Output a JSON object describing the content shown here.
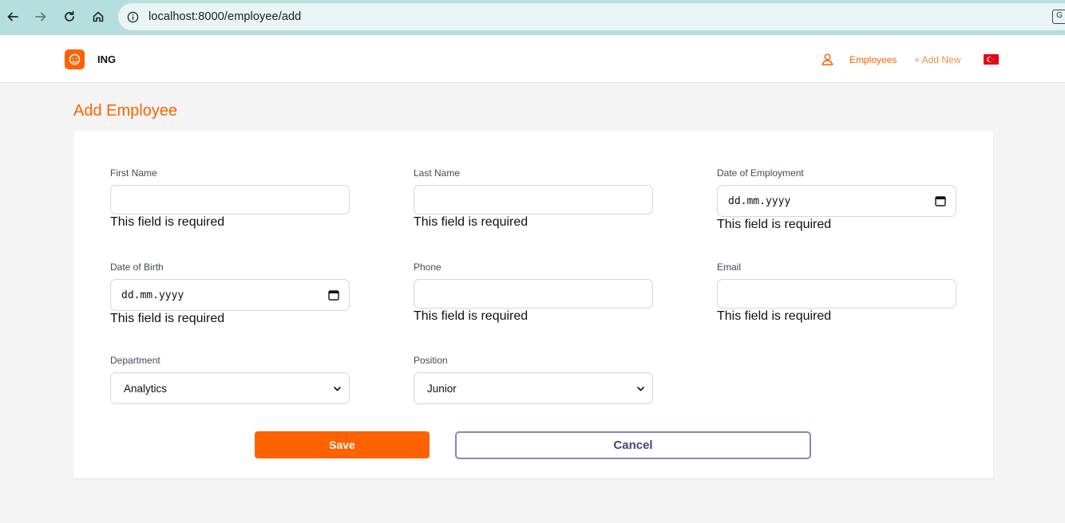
{
  "browser": {
    "url": "localhost:8000/employee/add",
    "nav_icons": [
      "back-arrow-icon",
      "forward-arrow-icon",
      "reload-icon",
      "home-icon",
      "info-icon",
      "translate-icon"
    ]
  },
  "header": {
    "brand": "ING",
    "nav": {
      "employees_label": "Employees",
      "add_new_label": "+ Add New"
    },
    "language_flag": "turkey-flag-icon",
    "accent_color": "#ff6200"
  },
  "page": {
    "title": "Add Employee"
  },
  "form": {
    "first_name": {
      "label": "First Name",
      "value": "",
      "error": "This field is required"
    },
    "last_name": {
      "label": "Last Name",
      "value": "",
      "error": "This field is required"
    },
    "date_of_employment": {
      "label": "Date of Employment",
      "placeholder": "dd.mm.yyyy",
      "error": "This field is required"
    },
    "date_of_birth": {
      "label": "Date of Birth",
      "placeholder": "dd.mm.yyyy",
      "error": "This field is required"
    },
    "phone": {
      "label": "Phone",
      "value": "",
      "error": "This field is required"
    },
    "email": {
      "label": "Email",
      "value": "",
      "error": "This field is required"
    },
    "department": {
      "label": "Department",
      "selected": "Analytics"
    },
    "position": {
      "label": "Position",
      "selected": "Junior"
    },
    "save_label": "Save",
    "cancel_label": "Cancel"
  },
  "colors": {
    "primary": "#ff6200",
    "cancel_border": "#8e82c2",
    "cancel_text": "#4a427a"
  }
}
